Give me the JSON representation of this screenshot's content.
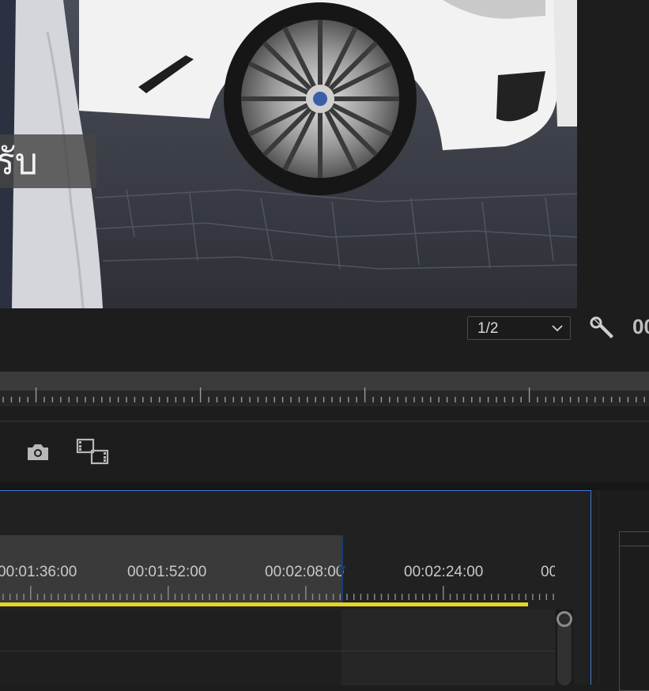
{
  "program_monitor": {
    "caption_text": "รับ",
    "zoom_level": "1/2",
    "timecode_partial": "00",
    "icons": [
      "wrench-icon",
      "chevron-down-icon"
    ]
  },
  "transport": {
    "icons": [
      "camera-icon",
      "compare-icon"
    ]
  },
  "timeline": {
    "timecodes": [
      "00:01:36:00",
      "00:01:52:00",
      "00:02:08:00",
      "00:02:24:00",
      "00"
    ],
    "work_area_color": "#e6d42a",
    "selection_color": "#3e7bd0"
  }
}
